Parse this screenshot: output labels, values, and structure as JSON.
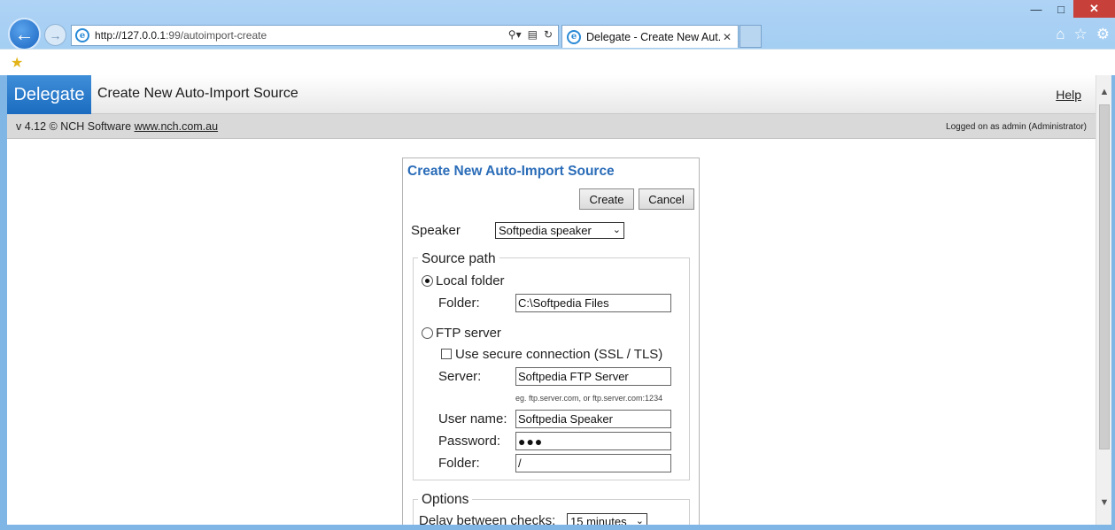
{
  "browser": {
    "url_host": "http://127.0.0.1",
    "url_rest": ":99/autoimport-create",
    "tab_title": "Delegate - Create New Aut...",
    "window_controls": [
      "minimize",
      "maximize",
      "close"
    ]
  },
  "app": {
    "brand": "Delegate",
    "page_title": "Create New Auto-Import Source",
    "help_link": "Help",
    "version_text": "v 4.12 © NCH Software",
    "version_link": "www.nch.com.au",
    "logged_on": "Logged on as admin (Administrator)"
  },
  "dialog": {
    "title": "Create New Auto-Import Source",
    "create_button": "Create",
    "cancel_button": "Cancel",
    "speaker_label": "Speaker",
    "speaker_value": "Softpedia speaker",
    "source_path": {
      "legend": "Source path",
      "local_folder_label": "Local folder",
      "local_folder_selected": true,
      "folder_label": "Folder:",
      "folder_value": "C:\\Softpedia Files",
      "ftp_label": "FTP server",
      "ftp_selected": false,
      "secure_label": "Use secure connection (SSL / TLS)",
      "secure_checked": false,
      "server_label": "Server:",
      "server_value": "Softpedia FTP Server",
      "server_hint": "eg. ftp.server.com, or ftp.server.com:1234",
      "username_label": "User name:",
      "username_value": "Softpedia Speaker",
      "password_label": "Password:",
      "password_value": "●●●",
      "ftp_folder_label": "Folder:",
      "ftp_folder_value": "/"
    },
    "options": {
      "legend": "Options",
      "delay_label": "Delay between checks:",
      "delay_value": "15 minutes"
    }
  }
}
